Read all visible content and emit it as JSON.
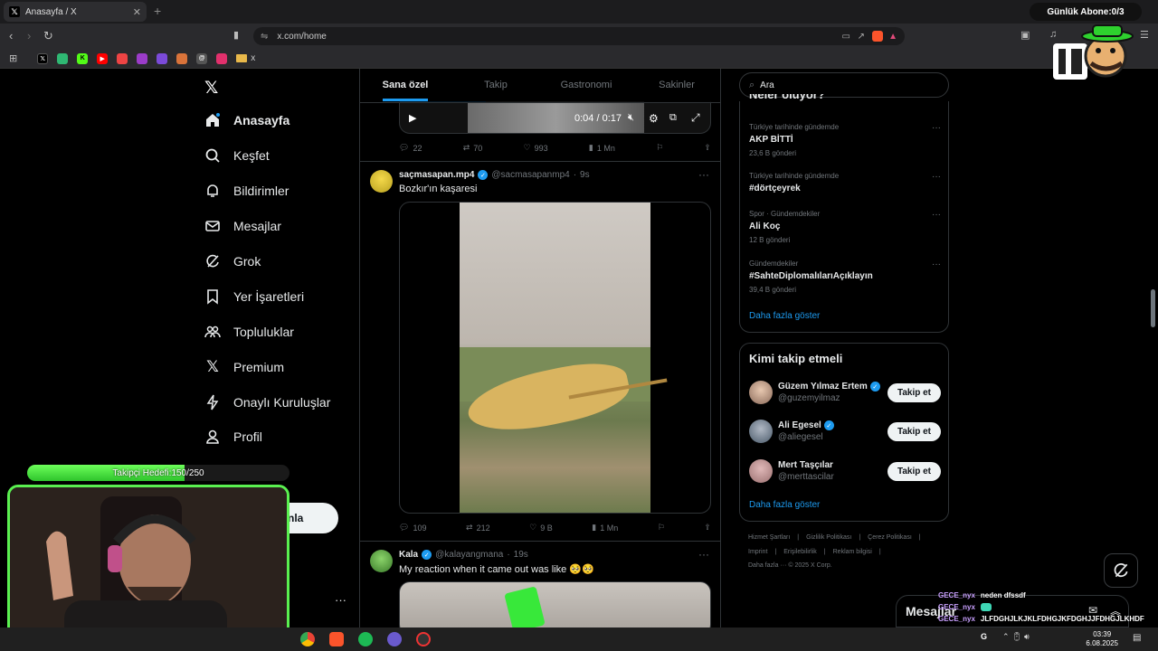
{
  "browser": {
    "tab_title": "Anasayfa / X",
    "url": "x.com/home",
    "bookmark_folder_label": "x"
  },
  "stream": {
    "sub_counter": "Günlük Abone:0/3",
    "follower_goal_label": "Takipçi Hedefi:",
    "follower_goal_value": "150/250",
    "follower_goal_fraction": 0.6,
    "chat": [
      {
        "user": "GECE_nyx",
        "message": "neden dfssdf"
      },
      {
        "user": "GECE_nyx",
        "message": ""
      },
      {
        "user": "GECE_nyx",
        "message": "JLFDGHJLKJKLFDHGJKFDGHJJFDHGJLKHDF"
      }
    ],
    "chat_panel_label": "Mesajlar",
    "taskbar_time": "03:39",
    "taskbar_date": "6.08.2025",
    "taskbar_lang": "G"
  },
  "sidebar": {
    "items": [
      {
        "label": "Anasayfa",
        "icon": "home-icon"
      },
      {
        "label": "Keşfet",
        "icon": "search-icon"
      },
      {
        "label": "Bildirimler",
        "icon": "bell-icon"
      },
      {
        "label": "Mesajlar",
        "icon": "mail-icon"
      },
      {
        "label": "Grok",
        "icon": "grok-icon"
      },
      {
        "label": "Yer İşaretleri",
        "icon": "bookmark-icon"
      },
      {
        "label": "Topluluklar",
        "icon": "communities-icon"
      },
      {
        "label": "Premium",
        "icon": "x-logo-icon"
      },
      {
        "label": "Onaylı Kuruluşlar",
        "icon": "lightning-icon"
      },
      {
        "label": "Profil",
        "icon": "person-icon"
      }
    ],
    "more_label_partial": "fazla",
    "post_button_partial": "nla"
  },
  "feed": {
    "tabs": [
      "Sana özel",
      "Takip",
      "Gastronomi",
      "Sakinler"
    ],
    "video_time": "0:04 / 0:17",
    "tweet0_stats": {
      "replies": "22",
      "reposts": "70",
      "likes": "993",
      "views": "1 Mn"
    },
    "tweet1": {
      "name": "saçmasapan.mp4",
      "handle": "@sacmasapanmp4",
      "time": "9s",
      "text": "Bozkır'ın kaşaresi",
      "stats": {
        "replies": "109",
        "reposts": "212",
        "likes": "9 B",
        "views": "1 Mn"
      }
    },
    "tweet2": {
      "name": "Kala",
      "handle": "@kalayangmana",
      "time": "19s",
      "text": "My reaction when it came out was like 🥺🥺"
    }
  },
  "right": {
    "search_placeholder": "Ara",
    "trends_title": "Neler oluyor?",
    "trends": [
      {
        "context": "Türkiye tarihinde gündemde",
        "title": "AKP BİTTİ",
        "count": "23,6 B gönderi"
      },
      {
        "context": "Türkiye tarihinde gündemde",
        "title": "#dörtçeyrek",
        "count": ""
      },
      {
        "context": "Spor · Gündemdekiler",
        "title": "Ali Koç",
        "count": "12 B gönderi"
      },
      {
        "context": "Gündemdekiler",
        "title": "#SahteDiplomalılarıAçıklayın",
        "count": "39,4 B gönderi"
      }
    ],
    "show_more": "Daha fazla göster",
    "who_to_follow_title": "Kimi takip etmeli",
    "follow_suggestions": [
      {
        "name": "Güzem Yılmaz Ertem",
        "handle": "@guzemyilmaz"
      },
      {
        "name": "Ali Egesel",
        "handle": "@aliegesel"
      },
      {
        "name": "Mert Taşçılar",
        "handle": "@merttascilar"
      }
    ],
    "follow_button": "Takip et",
    "footer_line1": [
      "Hizmet Şartları",
      "Gizlilik Politikası",
      "Çerez Politikası"
    ],
    "footer_line2": [
      "Imprint",
      "Erişilebilirlik",
      "Reklam bilgisi"
    ],
    "footer_line3": "Daha fazla ··· © 2025 X Corp."
  }
}
